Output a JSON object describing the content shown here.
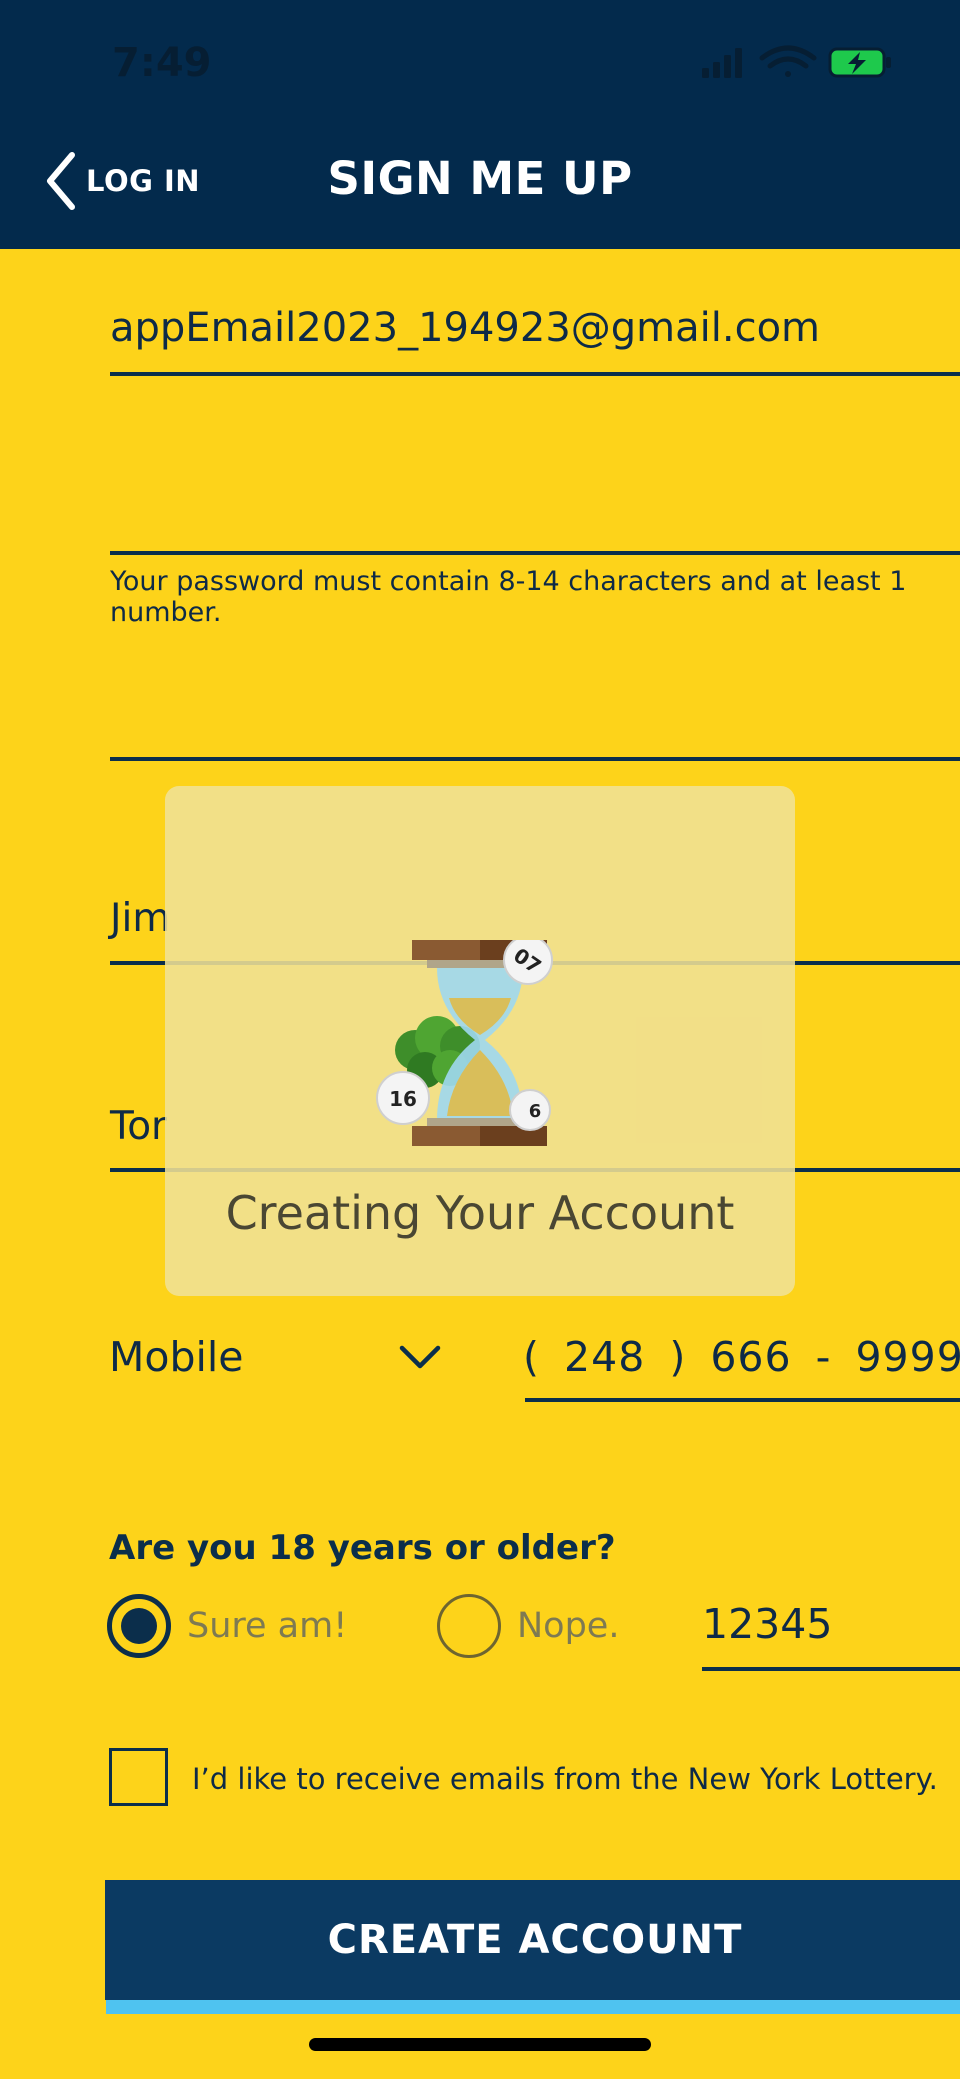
{
  "status_bar": {
    "time": "7:49"
  },
  "header": {
    "back_label": "LOG IN",
    "title": "SIGN ME UP"
  },
  "form": {
    "email_value": "appEmail2023_194923@gmail.com",
    "password_value": "",
    "password_helper": "Your password must contain 8-14 characters and at least 1 number.",
    "confirm_password_value": "",
    "first_name_value": "Jim",
    "last_name_value": "Tor",
    "phone_type": "Mobile",
    "phone_value": "( 248 ) 666 - 9999",
    "age_question": "Are you 18 years or older?",
    "age_yes_label": "Sure am!",
    "age_no_label": "Nope.",
    "zip_value": "12345",
    "email_optin_label": "I’d like to receive emails from the New York Lottery.",
    "submit_label": "CREATE ACCOUNT"
  },
  "overlay": {
    "message": "Creating Your Account"
  },
  "colors": {
    "background": "#FDD31A",
    "header": "#032A4C",
    "button": "#0B3A62",
    "button_accent": "#4FC3F0"
  }
}
